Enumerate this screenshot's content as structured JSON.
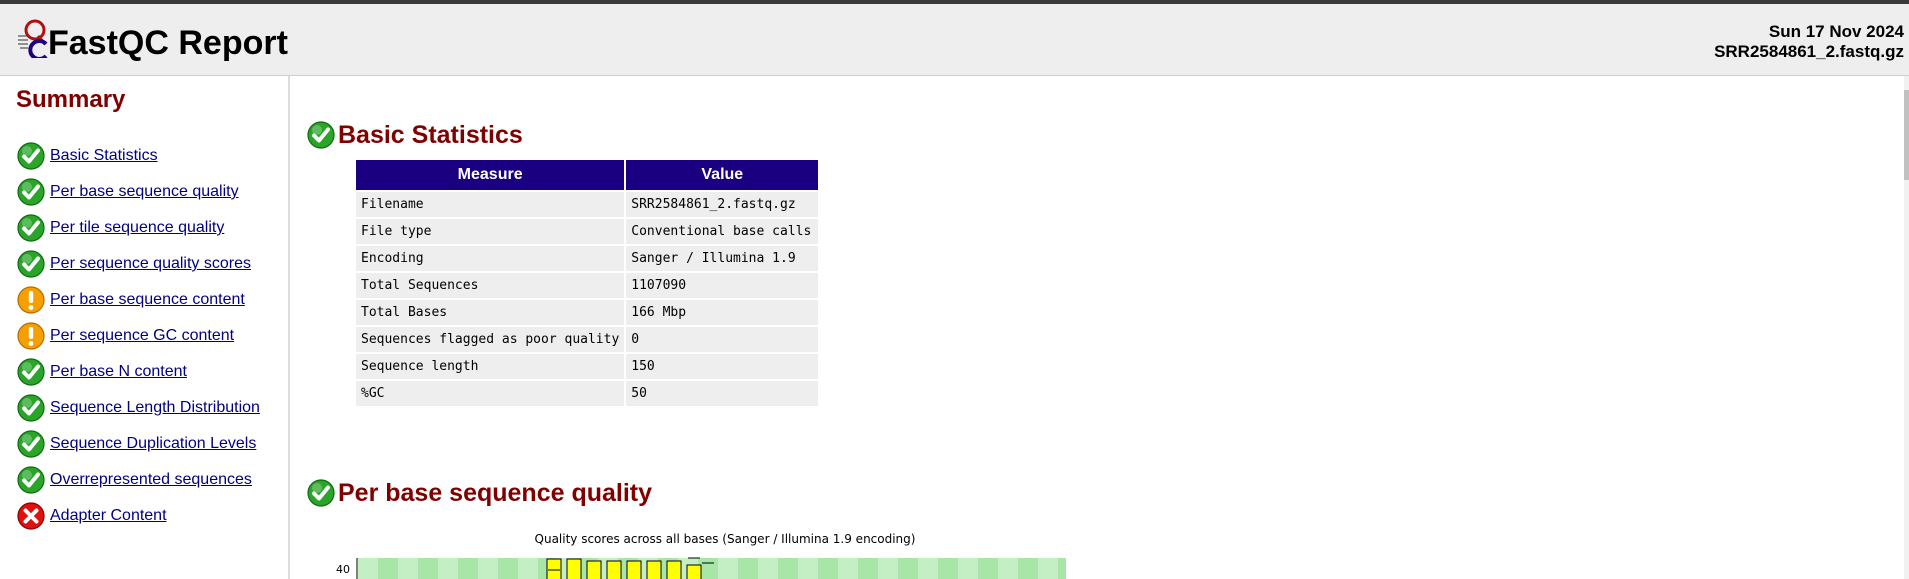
{
  "header": {
    "title": "FastQC Report",
    "date": "Sun 17 Nov 2024",
    "filename": "SRR2584861_2.fastq.gz"
  },
  "summary": {
    "heading": "Summary",
    "items": [
      {
        "label": "Basic Statistics",
        "status": "pass"
      },
      {
        "label": "Per base sequence quality",
        "status": "pass"
      },
      {
        "label": "Per tile sequence quality",
        "status": "pass"
      },
      {
        "label": "Per sequence quality scores",
        "status": "pass"
      },
      {
        "label": "Per base sequence content",
        "status": "warn"
      },
      {
        "label": "Per sequence GC content",
        "status": "warn"
      },
      {
        "label": "Per base N content",
        "status": "pass"
      },
      {
        "label": "Sequence Length Distribution",
        "status": "pass"
      },
      {
        "label": "Sequence Duplication Levels",
        "status": "pass"
      },
      {
        "label": "Overrepresented sequences",
        "status": "pass"
      },
      {
        "label": "Adapter Content",
        "status": "fail"
      }
    ]
  },
  "basic_stats": {
    "heading": "Basic Statistics",
    "status": "pass",
    "columns": [
      "Measure",
      "Value"
    ],
    "rows": [
      [
        "Filename",
        "SRR2584861_2.fastq.gz"
      ],
      [
        "File type",
        "Conventional base calls"
      ],
      [
        "Encoding",
        "Sanger / Illumina 1.9"
      ],
      [
        "Total Sequences",
        "1107090"
      ],
      [
        "Total Bases",
        "166 Mbp"
      ],
      [
        "Sequences flagged as poor quality",
        "0"
      ],
      [
        "Sequence length",
        "150"
      ],
      [
        "%GC",
        "50"
      ]
    ]
  },
  "per_base_quality": {
    "heading": "Per base sequence quality",
    "status": "pass",
    "chart_title": "Quality scores across all bases (Sanger / Illumina 1.9 encoding)",
    "y_tick_top": "40"
  },
  "colors": {
    "pass": "#2aa52a",
    "warn": "#f5a000",
    "fail": "#e01010",
    "heading": "#800000",
    "table_header": "#1a0080",
    "link": "#000080"
  }
}
